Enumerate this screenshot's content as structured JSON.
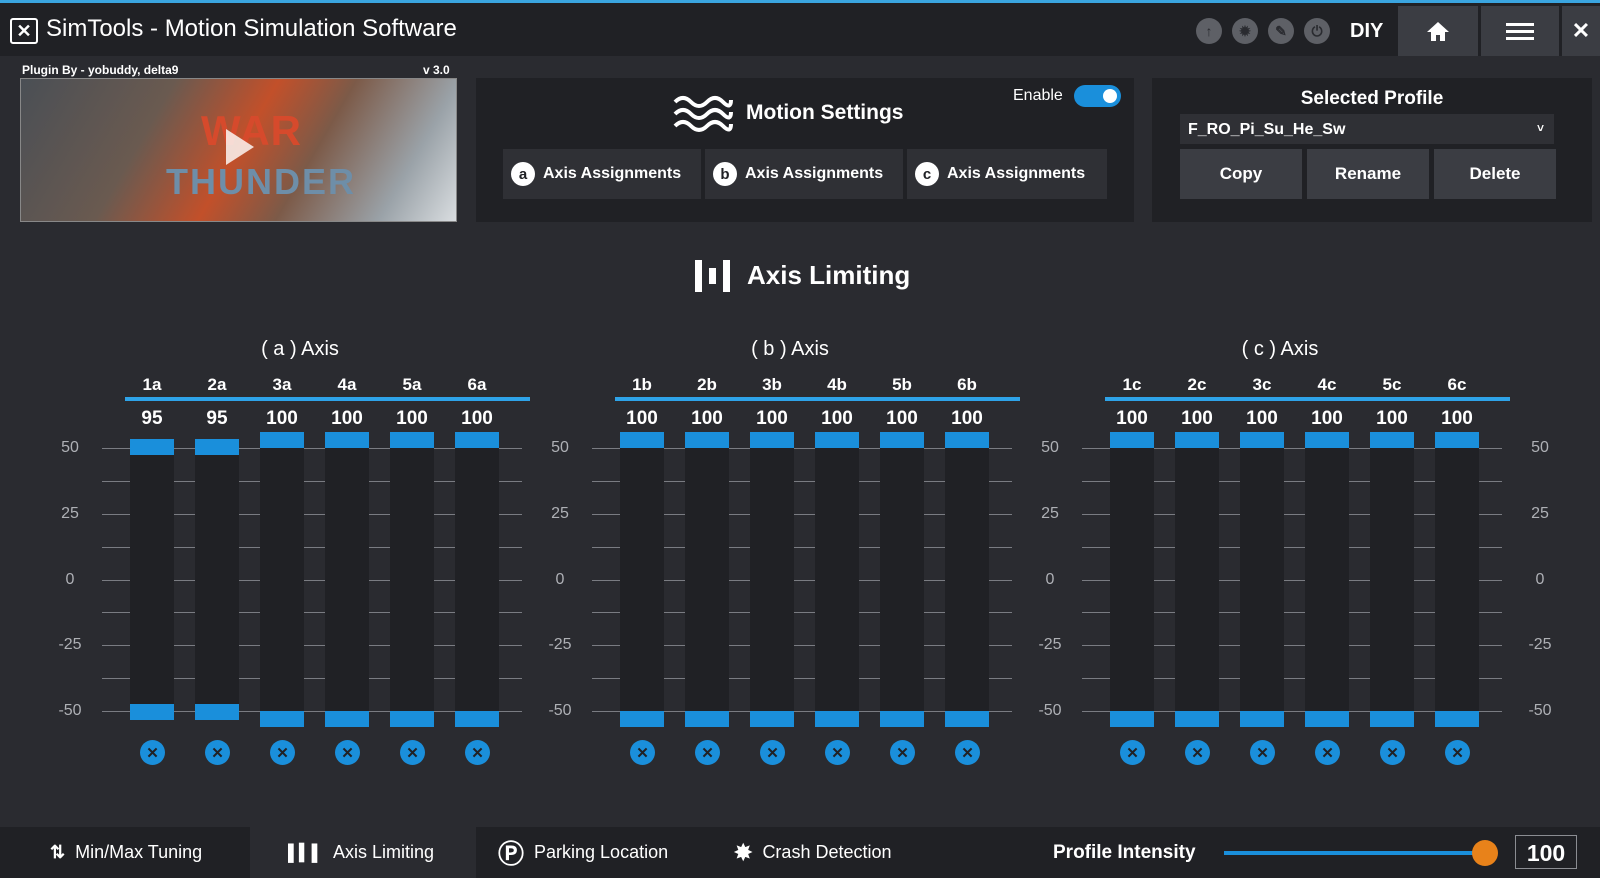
{
  "window": {
    "title": "SimTools - Motion Simulation Software",
    "logo_icon": "simtools-logo-icon",
    "diy_label": "DIY",
    "home_icon": "home-icon",
    "menu_icon": "menu-icon",
    "close_icon": "close-icon",
    "close_glyph": "✕"
  },
  "plugin": {
    "by": "Plugin By - yobuddy, delta9",
    "version": "v 3.0",
    "banner_word1": "WAR",
    "banner_word2": "THUNDER"
  },
  "motion_settings": {
    "title": "Motion Settings",
    "enable_label": "Enable",
    "enabled": true,
    "assign_buttons": [
      {
        "letter": "a",
        "label": "Axis Assignments"
      },
      {
        "letter": "b",
        "label": "Axis Assignments"
      },
      {
        "letter": "c",
        "label": "Axis Assignments"
      }
    ]
  },
  "profile": {
    "title": "Selected Profile",
    "selected": "F_RO_Pi_Su_He_Sw",
    "chevron": "˅",
    "copy_label": "Copy",
    "rename_label": "Rename",
    "delete_label": "Delete"
  },
  "axis_limiting": {
    "title": "Axis Limiting",
    "scale": [
      "50",
      "25",
      "0",
      "-25",
      "-50"
    ],
    "groups": [
      {
        "title": "( a ) Axis",
        "columns": [
          {
            "label": "1a",
            "value": "95"
          },
          {
            "label": "2a",
            "value": "95"
          },
          {
            "label": "3a",
            "value": "100"
          },
          {
            "label": "4a",
            "value": "100"
          },
          {
            "label": "5a",
            "value": "100"
          },
          {
            "label": "6a",
            "value": "100"
          }
        ]
      },
      {
        "title": "( b ) Axis",
        "columns": [
          {
            "label": "1b",
            "value": "100"
          },
          {
            "label": "2b",
            "value": "100"
          },
          {
            "label": "3b",
            "value": "100"
          },
          {
            "label": "4b",
            "value": "100"
          },
          {
            "label": "5b",
            "value": "100"
          },
          {
            "label": "6b",
            "value": "100"
          }
        ]
      },
      {
        "title": "( c ) Axis",
        "columns": [
          {
            "label": "1c",
            "value": "100"
          },
          {
            "label": "2c",
            "value": "100"
          },
          {
            "label": "3c",
            "value": "100"
          },
          {
            "label": "4c",
            "value": "100"
          },
          {
            "label": "5c",
            "value": "100"
          },
          {
            "label": "6c",
            "value": "100"
          }
        ]
      }
    ]
  },
  "bottom_tabs": [
    {
      "label": "Min/Max Tuning",
      "icon": "arrows-updown-icon",
      "glyph": "⇅",
      "active": false
    },
    {
      "label": "Axis Limiting",
      "icon": "axis-limiting-icon",
      "glyph": "▌▍▌",
      "active": true
    },
    {
      "label": "Parking Location",
      "icon": "parking-icon",
      "glyph": "Ⓟ",
      "active": false
    },
    {
      "label": "Crash Detection",
      "icon": "crash-icon",
      "glyph": "✸",
      "active": false
    }
  ],
  "intensity": {
    "label": "Profile Intensity",
    "value": "100",
    "fraction": 1.0
  },
  "colors": {
    "accent": "#1a8fdb",
    "slider_thumb": "#e8821a"
  }
}
